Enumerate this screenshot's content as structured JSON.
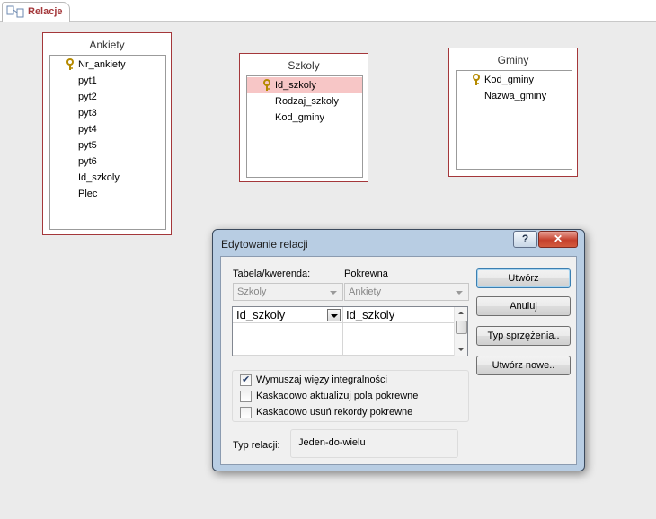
{
  "document_tab": {
    "label": "Relacje",
    "icon": "relationships-icon"
  },
  "tables": [
    {
      "title": "Ankiety",
      "fields": [
        "Nr_ankiety",
        "pyt1",
        "pyt2",
        "pyt3",
        "pyt4",
        "pyt5",
        "pyt6",
        "Id_szkoly",
        "Plec"
      ],
      "primary_key": "Nr_ankiety"
    },
    {
      "title": "Szkoly",
      "fields": [
        "Id_szkoly",
        "Rodzaj_szkoly",
        "Kod_gminy"
      ],
      "primary_key": "Id_szkoly",
      "selected": "Id_szkoly"
    },
    {
      "title": "Gminy",
      "fields": [
        "Kod_gminy",
        "Nazwa_gminy"
      ],
      "primary_key": "Kod_gminy"
    }
  ],
  "dialog": {
    "title": "Edytowanie relacji",
    "help_label": "?",
    "close_label": "✕",
    "table_label": "Tabela/kwerenda:",
    "related_label": "Pokrewna",
    "table_value": "Szkoly",
    "related_value": "Ankiety",
    "grid_rows": [
      {
        "left": "Id_szkoly",
        "right": "Id_szkoly"
      },
      {
        "left": "",
        "right": ""
      },
      {
        "left": "",
        "right": ""
      }
    ],
    "checkboxes": [
      {
        "label": "Wymuszaj więzy integralności",
        "checked": true
      },
      {
        "label": "Kaskadowo aktualizuj pola pokrewne",
        "checked": false
      },
      {
        "label": "Kaskadowo usuń rekordy pokrewne",
        "checked": false
      }
    ],
    "relation_type_label": "Typ relacji:",
    "relation_type_value": "Jeden-do-wielu",
    "buttons": {
      "create": "Utwórz",
      "cancel": "Anuluj",
      "join_type": "Typ sprzężenia..",
      "create_new": "Utwórz nowe.."
    }
  },
  "colors": {
    "table_border": "#a4373a",
    "selected_field": "#f7c6c6",
    "dialog_frame": "#b8cde3",
    "close_button": "#c5402c"
  }
}
